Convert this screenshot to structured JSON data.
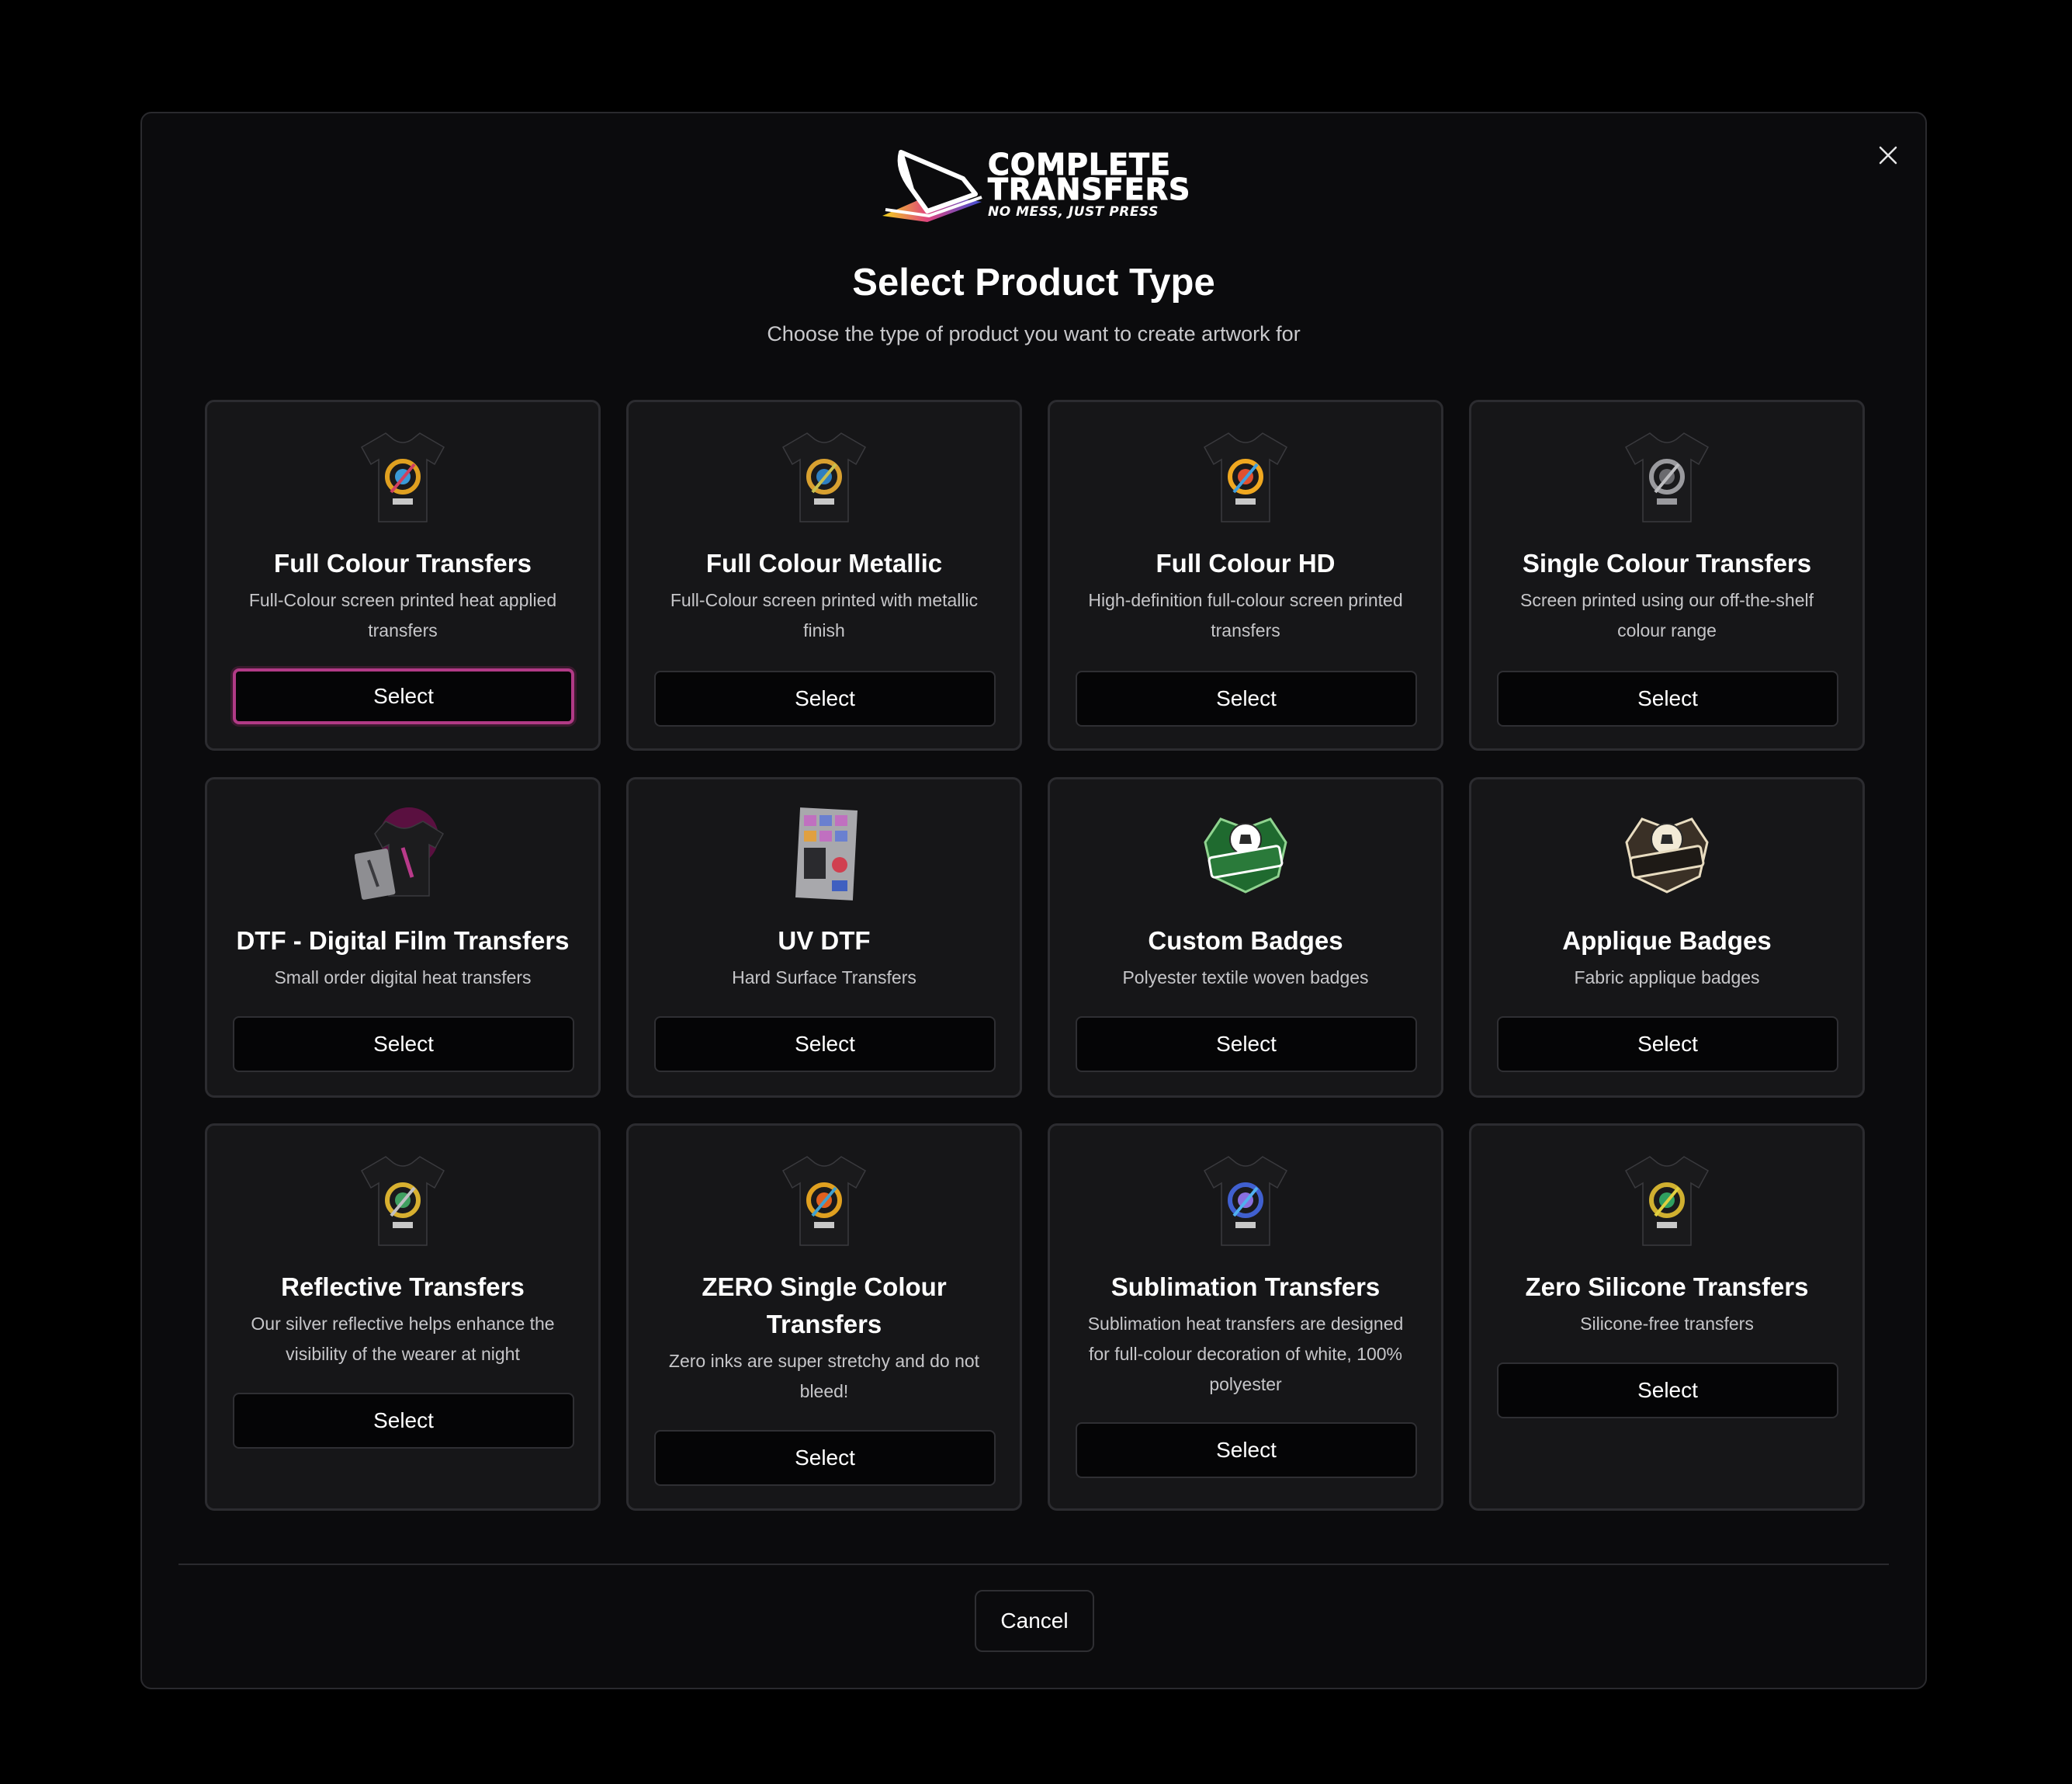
{
  "modal": {
    "logo": {
      "line1": "COMPLETE",
      "line2": "TRANSFERS",
      "tagline": "NO MESS, JUST PRESS"
    },
    "title": "Select Product Type",
    "subtitle": "Choose the type of product you want to create artwork for",
    "close_label": "×",
    "cancel_label": "Cancel",
    "accent_color": "#b13a86",
    "products": [
      {
        "name": "Full Colour Transfers",
        "description": "Full-Colour screen printed heat applied transfers",
        "button": "Select",
        "image": "tshirt-dragon-color-icon",
        "focused": true
      },
      {
        "name": "Full Colour Metallic",
        "description": "Full-Colour screen printed with metallic finish",
        "button": "Select",
        "image": "tshirt-dragon-metallic-icon"
      },
      {
        "name": "Full Colour HD",
        "description": "High-definition full-colour screen printed transfers",
        "button": "Select",
        "image": "tshirt-dragon-hd-icon"
      },
      {
        "name": "Single Colour Transfers",
        "description": "Screen printed using our off-the-shelf colour range",
        "button": "Select",
        "image": "tshirt-dragon-mono-icon"
      },
      {
        "name": "DTF - Digital Film Transfers",
        "description": "Small order digital heat transfers",
        "button": "Select",
        "image": "dtf-film-icon"
      },
      {
        "name": "UV DTF",
        "description": "Hard Surface Transfers",
        "button": "Select",
        "image": "uv-dtf-sheet-icon"
      },
      {
        "name": "Custom Badges",
        "description": "Polyester textile woven badges",
        "button": "Select",
        "image": "football-badge-green-icon"
      },
      {
        "name": "Applique Badges",
        "description": "Fabric applique badges",
        "button": "Select",
        "image": "football-badge-cream-icon"
      },
      {
        "name": "Reflective Transfers",
        "description": "Our silver reflective helps enhance the visibility of the wearer at night",
        "button": "Select",
        "image": "tshirt-dragon-reflective-icon"
      },
      {
        "name": "ZERO Single Colour Transfers",
        "description": "Zero inks are super stretchy and do not bleed!",
        "button": "Select",
        "image": "tshirt-dragon-zero-icon"
      },
      {
        "name": "Sublimation Transfers",
        "description": "Sublimation heat transfers are designed for full-colour decoration of white, 100% polyester",
        "button": "Select",
        "image": "tshirt-dragon-blue-icon"
      },
      {
        "name": "Zero Silicone Transfers",
        "description": "Silicone-free transfers",
        "button": "Select",
        "image": "tshirt-dragon-green-icon"
      }
    ]
  }
}
